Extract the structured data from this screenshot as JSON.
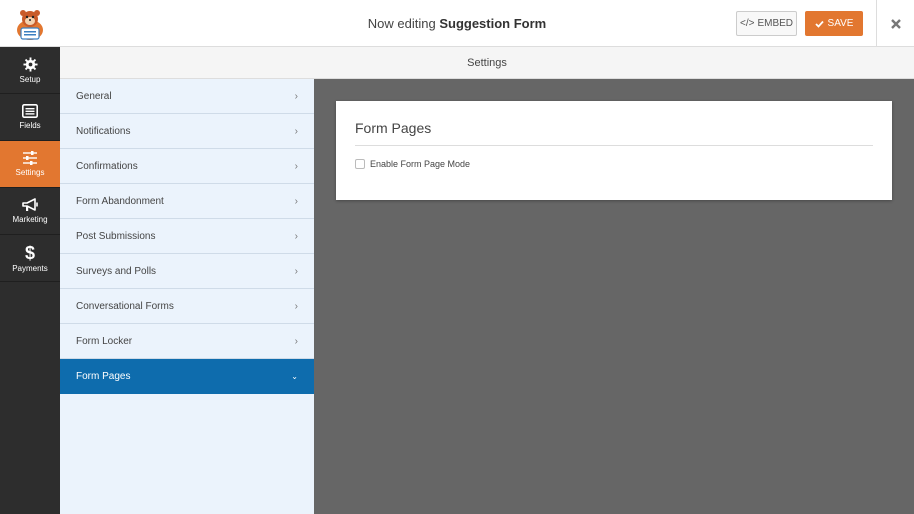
{
  "header": {
    "title_prefix": "Now editing",
    "form_name": "Suggestion Form",
    "embed_label": "EMBED",
    "save_label": "SAVE",
    "brand_color": "#e27730"
  },
  "leftnav": {
    "items": [
      {
        "label": "Setup",
        "icon": "gear-icon"
      },
      {
        "label": "Fields",
        "icon": "list-icon"
      },
      {
        "label": "Settings",
        "icon": "sliders-icon",
        "active": true
      },
      {
        "label": "Marketing",
        "icon": "megaphone-icon"
      },
      {
        "label": "Payments",
        "icon": "dollar-icon"
      }
    ]
  },
  "settings_bar": {
    "title": "Settings"
  },
  "panels": {
    "items": [
      {
        "label": "General"
      },
      {
        "label": "Notifications"
      },
      {
        "label": "Confirmations"
      },
      {
        "label": "Form Abandonment"
      },
      {
        "label": "Post Submissions"
      },
      {
        "label": "Surveys and Polls"
      },
      {
        "label": "Conversational Forms"
      },
      {
        "label": "Form Locker"
      },
      {
        "label": "Form Pages",
        "active": true
      }
    ],
    "active_color": "#0e6cad"
  },
  "content": {
    "card_title": "Form Pages",
    "checkbox_label": "Enable Form Page Mode",
    "checkbox_checked": false
  }
}
